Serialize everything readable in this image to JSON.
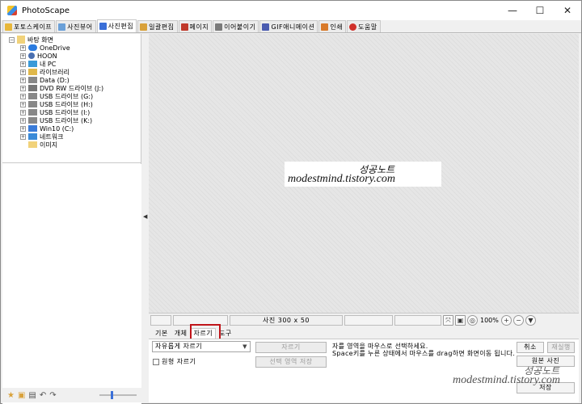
{
  "window": {
    "title": "PhotoScape",
    "controls": {
      "minimize": "—",
      "maximize": "☐",
      "close": "✕"
    }
  },
  "tabs": [
    {
      "label": "포토스케이프",
      "icon": "photoscape-icon",
      "color": "#e8b73a"
    },
    {
      "label": "사진뷰어",
      "icon": "viewer-icon",
      "color": "#6aa0d8"
    },
    {
      "label": "사진편집",
      "icon": "editor-icon",
      "color": "#3a6fd8",
      "active": true
    },
    {
      "label": "일괄편집",
      "icon": "batch-icon",
      "color": "#d9a13a"
    },
    {
      "label": "페이지",
      "icon": "page-icon",
      "color": "#c0392b"
    },
    {
      "label": "이어붙이기",
      "icon": "combine-icon",
      "color": "#7a7a7a"
    },
    {
      "label": "GIF애니메이션",
      "icon": "gif-icon",
      "color": "#4a5bb0"
    },
    {
      "label": "인쇄",
      "icon": "print-icon",
      "color": "#d97a2a"
    },
    {
      "label": "도움말",
      "icon": "help-icon",
      "color": "#d0302a"
    }
  ],
  "tree": {
    "root": "바탕 화면",
    "items": [
      {
        "label": "OneDrive",
        "icon": "onedrive-icon",
        "color": "#2a7be0"
      },
      {
        "label": "HOON",
        "icon": "user-icon",
        "color": "#4a6fb0"
      },
      {
        "label": "내 PC",
        "icon": "pc-icon",
        "color": "#3a9ad8"
      },
      {
        "label": "라이브러리",
        "icon": "library-icon",
        "color": "#e0b84a"
      },
      {
        "label": "Data (D:)",
        "icon": "drive-icon",
        "color": "#888888"
      },
      {
        "label": "DVD RW 드라이브 (J:)",
        "icon": "dvd-icon",
        "color": "#777777"
      },
      {
        "label": "USB 드라이브 (G:)",
        "icon": "usb-icon",
        "color": "#888888"
      },
      {
        "label": "USB 드라이브 (H:)",
        "icon": "usb-icon",
        "color": "#888888"
      },
      {
        "label": "USB 드라이브 (I:)",
        "icon": "usb-icon",
        "color": "#888888"
      },
      {
        "label": "USB 드라이브 (K:)",
        "icon": "usb-icon",
        "color": "#888888"
      },
      {
        "label": "Win10 (C:)",
        "icon": "windows-drive-icon",
        "color": "#3a7bd8"
      },
      {
        "label": "네트워크",
        "icon": "network-icon",
        "color": "#3a8ad8"
      },
      {
        "label": "이미지",
        "icon": "folder-icon",
        "color": "#f1d27a"
      }
    ]
  },
  "photo": {
    "line1": "성공노트",
    "line2": "modestmind.tistory.com"
  },
  "status": {
    "size_text": "사진 300 x 50",
    "zoom": "100%"
  },
  "edit_tabs": [
    "기본",
    "개체",
    "자르기",
    "도구"
  ],
  "crop_panel": {
    "mode_select": "자유롭게 자르기",
    "round_crop_label": "원형 자르기",
    "crop_button": "자르기",
    "save_selection_button": "선택 영역 저장",
    "help_line1": "자를 영역을 마우스로 선택하세요.",
    "help_line2": "Space키를 누른 상태에서 마우스를 drag하면 화면이동 됩니다."
  },
  "right_buttons": {
    "cancel": "취소",
    "redo": "재실행",
    "original": "원본 사진",
    "save": "저장"
  },
  "watermark": {
    "line1": "성공노트",
    "line2": "modestmind.tistory.com"
  }
}
